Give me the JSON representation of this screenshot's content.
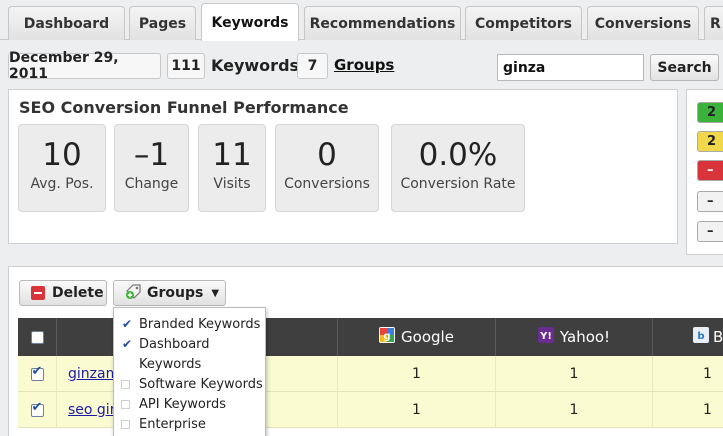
{
  "tabs": [
    {
      "label": "Dashboard"
    },
    {
      "label": "Pages"
    },
    {
      "label": "Keywords"
    },
    {
      "label": "Recommendations"
    },
    {
      "label": "Competitors"
    },
    {
      "label": "Conversions"
    },
    {
      "label": "R"
    }
  ],
  "toolbar": {
    "date": "December 29, 2011",
    "keyword_count": "111",
    "keywords_label": "Keywords",
    "group_count": "7",
    "groups_label": "Groups",
    "search_value": "ginza",
    "search_button": "Search"
  },
  "funnel": {
    "title": "SEO Conversion Funnel Performance",
    "stats": [
      {
        "value": "10",
        "label": "Avg. Pos."
      },
      {
        "value": "–1",
        "label": "Change"
      },
      {
        "value": "11",
        "label": "Visits"
      },
      {
        "value": "0",
        "label": "Conversions"
      },
      {
        "value": "0.0%",
        "label": "Conversion Rate"
      }
    ]
  },
  "side_badges": [
    {
      "text": "2",
      "color": "#3bb33b"
    },
    {
      "text": "2",
      "color": "#f0d84a"
    },
    {
      "text": "–",
      "color": "#d8343a"
    },
    {
      "text": "–",
      "color": "#f2f2f2"
    },
    {
      "text": "–",
      "color": "#f2f2f2"
    }
  ],
  "actions": {
    "delete_label": "Delete",
    "groups_label": "Groups"
  },
  "table": {
    "columns": [
      "Google",
      "Yahoo!",
      "B"
    ],
    "rows": [
      {
        "keyword": "ginzam",
        "google": "1",
        "yahoo": "1",
        "bing": "1"
      },
      {
        "keyword": "seo gir",
        "google": "1",
        "yahoo": "1",
        "bing": "1"
      }
    ]
  },
  "groups_menu": {
    "items": [
      {
        "label": "Branded Keywords",
        "checked": true
      },
      {
        "label": "Dashboard",
        "checked": true
      },
      {
        "label": "Keywords",
        "checked": null
      },
      {
        "label": "Software Keywords",
        "checked": false
      },
      {
        "label": "API Keywords",
        "checked": false
      },
      {
        "label": "Enterprise",
        "checked": false
      }
    ]
  }
}
